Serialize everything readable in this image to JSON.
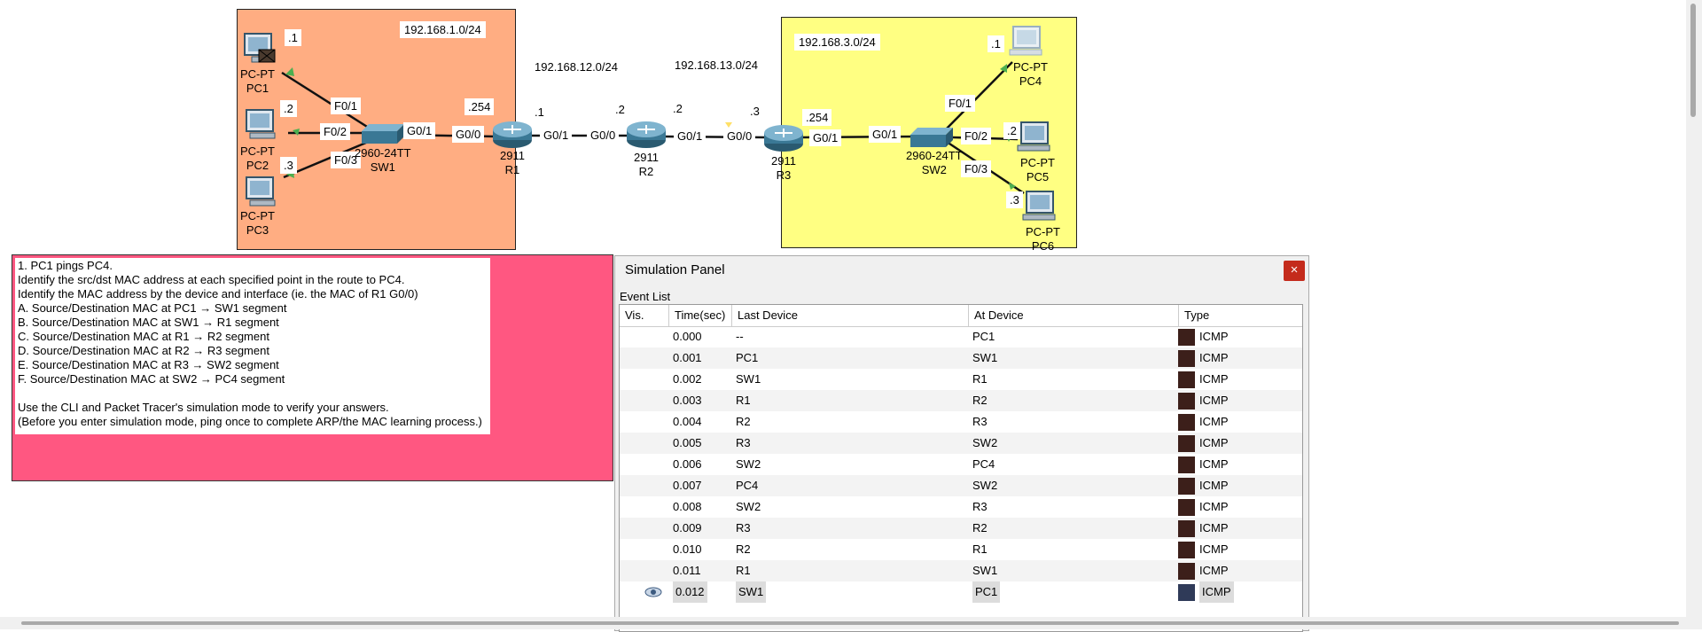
{
  "topology": {
    "left_network": "192.168.1.0/24",
    "link_r1_r2": "192.168.12.0/24",
    "link_r2_r3": "192.168.13.0/24",
    "right_network": "192.168.3.0/24",
    "devices": {
      "pc1": {
        "type": "PC-PT",
        "name": "PC1"
      },
      "pc2": {
        "type": "PC-PT",
        "name": "PC2"
      },
      "pc3": {
        "type": "PC-PT",
        "name": "PC3"
      },
      "sw1": {
        "type": "2960-24TT",
        "name": "SW1"
      },
      "r1": {
        "type": "2911",
        "name": "R1"
      },
      "r2": {
        "type": "2911",
        "name": "R2"
      },
      "r3": {
        "type": "2911",
        "name": "R3"
      },
      "sw2": {
        "type": "2960-24TT",
        "name": "SW2"
      },
      "pc4": {
        "type": "PC-PT",
        "name": "PC4"
      },
      "pc5": {
        "type": "PC-PT",
        "name": "PC5"
      },
      "pc6": {
        "type": "PC-PT",
        "name": "PC6"
      }
    },
    "labels": {
      "pc1_host": ".1",
      "pc2_host": ".2",
      "pc3_host": ".3",
      "sw1_f01": "F0/1",
      "sw1_f02": "F0/2",
      "sw1_f03": "F0/3",
      "sw1_g01": "G0/1",
      "r1_g00": "G0/0",
      "r1_host": ".254",
      "r1_g01_host": ".1",
      "r1_g01": "G0/1",
      "r2_g00_host": ".2",
      "r2_g00": "G0/0",
      "r2_g01_host": ".2",
      "r2_g01": "G0/1",
      "r3_g00": "G0/0",
      "r3_g00_host": ".3",
      "r3_host": ".254",
      "r3_g01": "G0/1",
      "sw2_g01": "G0/1",
      "sw2_f01": "F0/1",
      "sw2_f02": "F0/2",
      "sw2_f03": "F0/3",
      "pc4_host": ".1",
      "pc5_host": ".2",
      "pc6_host": ".3"
    }
  },
  "instructions": {
    "lines": [
      "1. PC1 pings PC4.",
      "Identify the src/dst MAC address at each specified point in the route to PC4.",
      "Identify the MAC address by the device and interface (ie. the MAC of R1 G0/0)",
      "A. Source/Destination MAC at PC1 → SW1 segment",
      "B. Source/Destination MAC at SW1 → R1 segment",
      "C. Source/Destination MAC at R1 → R2 segment",
      "D. Source/Destination MAC at R2 → R3 segment",
      "E. Source/Destination MAC at R3 → SW2 segment",
      "F. Source/Destination MAC at SW2 → PC4 segment",
      "",
      "Use the CLI and Packet Tracer's simulation mode to verify your answers.",
      "(Before you enter simulation mode, ping once to complete ARP/the MAC learning process.)"
    ]
  },
  "simulation_panel": {
    "title": "Simulation Panel",
    "close": "×",
    "event_list_label": "Event List",
    "columns": [
      "Vis.",
      "Time(sec)",
      "Last Device",
      "At Device",
      "Type"
    ],
    "events": [
      {
        "time": "0.000",
        "last": "--",
        "at": "PC1",
        "type": "ICMP"
      },
      {
        "time": "0.001",
        "last": "PC1",
        "at": "SW1",
        "type": "ICMP"
      },
      {
        "time": "0.002",
        "last": "SW1",
        "at": "R1",
        "type": "ICMP"
      },
      {
        "time": "0.003",
        "last": "R1",
        "at": "R2",
        "type": "ICMP"
      },
      {
        "time": "0.004",
        "last": "R2",
        "at": "R3",
        "type": "ICMP"
      },
      {
        "time": "0.005",
        "last": "R3",
        "at": "SW2",
        "type": "ICMP"
      },
      {
        "time": "0.006",
        "last": "SW2",
        "at": "PC4",
        "type": "ICMP"
      },
      {
        "time": "0.007",
        "last": "PC4",
        "at": "SW2",
        "type": "ICMP"
      },
      {
        "time": "0.008",
        "last": "SW2",
        "at": "R3",
        "type": "ICMP"
      },
      {
        "time": "0.009",
        "last": "R3",
        "at": "R2",
        "type": "ICMP"
      },
      {
        "time": "0.010",
        "last": "R2",
        "at": "R1",
        "type": "ICMP"
      },
      {
        "time": "0.011",
        "last": "R1",
        "at": "SW1",
        "type": "ICMP"
      },
      {
        "time": "0.012",
        "last": "SW1",
        "at": "PC1",
        "type": "ICMP",
        "selected": true
      }
    ]
  },
  "colors": {
    "left_zone": "#ffad82",
    "right_zone": "#ffff82",
    "note_box": "#ff5781",
    "icmp_swatch": "#3c1f1a",
    "icmp_swatch_selected": "#2f3a58",
    "close_button": "#c42b1c"
  }
}
